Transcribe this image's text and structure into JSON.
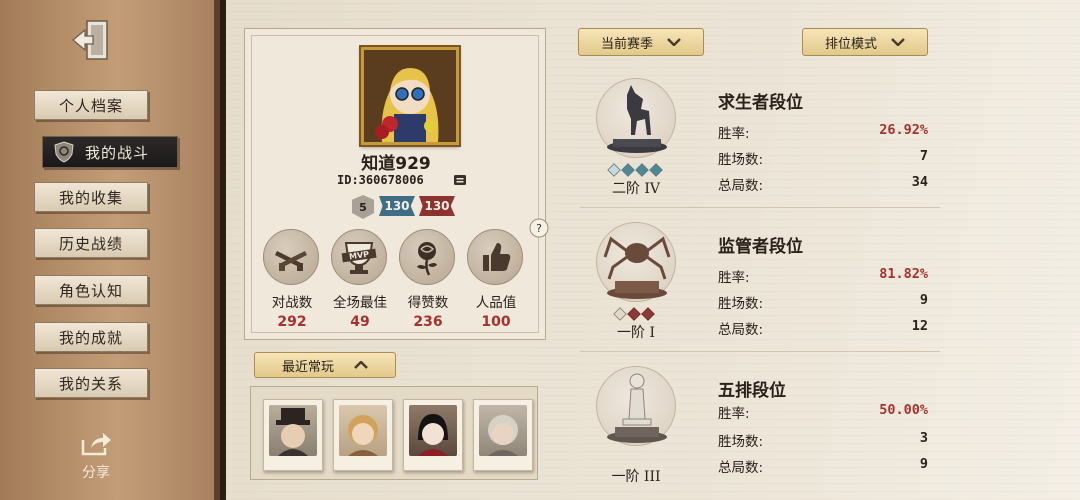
{
  "sidebar": {
    "exit_icon": "door-exit-icon",
    "items": [
      {
        "label": "个人档案",
        "active": false
      },
      {
        "label": "我的战斗",
        "active": true
      },
      {
        "label": "我的收集",
        "active": false
      },
      {
        "label": "历史战绩",
        "active": false
      },
      {
        "label": "角色认知",
        "active": false
      },
      {
        "label": "我的成就",
        "active": false
      },
      {
        "label": "我的关系",
        "active": false
      }
    ],
    "share_label": "分享"
  },
  "profile": {
    "name": "知道929",
    "id": "ID:360678006",
    "level": "5",
    "flag_blue": "130",
    "flag_red": "130",
    "stats": [
      {
        "label": "对战数",
        "value": "292",
        "icon": "crossed-guns-icon"
      },
      {
        "label": "全场最佳",
        "value": "49",
        "icon": "mvp-trophy-icon"
      },
      {
        "label": "得赞数",
        "value": "236",
        "icon": "rose-icon"
      },
      {
        "label": "人品值",
        "value": "100",
        "icon": "thumbs-up-icon"
      }
    ]
  },
  "recent": {
    "button_label": "最近常玩"
  },
  "filters": {
    "season_label": "当前赛季",
    "mode_label": "排位模式"
  },
  "ranks": [
    {
      "title": "求生者段位",
      "tier": "二阶 IV",
      "win_rate_label": "胜率:",
      "win_rate": "26.92%",
      "wins_label": "胜场数:",
      "wins": "7",
      "total_label": "总局数:",
      "total": "34"
    },
    {
      "title": "监管者段位",
      "tier": "一阶 I",
      "win_rate_label": "胜率:",
      "win_rate": "81.82%",
      "wins_label": "胜场数:",
      "wins": "9",
      "total_label": "总局数:",
      "total": "12"
    },
    {
      "title": "五排段位",
      "tier": "一阶 III",
      "win_rate_label": "胜率:",
      "win_rate": "50.00%",
      "wins_label": "胜场数:",
      "wins": "3",
      "total_label": "总局数:",
      "total": "9"
    }
  ],
  "colors": {
    "accent_red": "#a5322c",
    "gold_button": "#e2c98a",
    "sidebar_brown": "#a27a57"
  }
}
